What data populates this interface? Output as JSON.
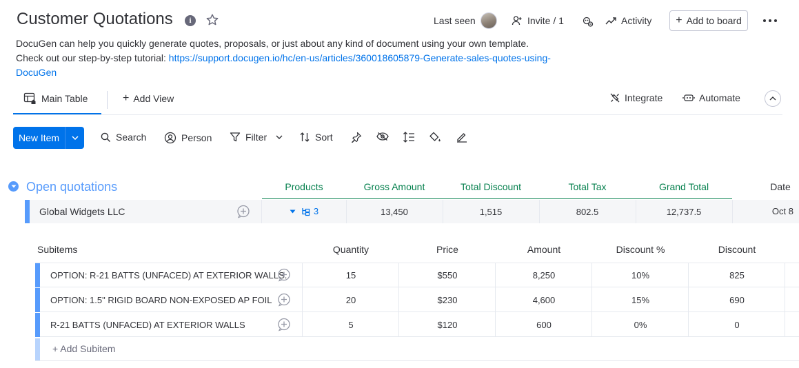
{
  "header": {
    "title": "Customer Quotations",
    "last_seen_label": "Last seen",
    "invite_label": "Invite / 1",
    "activity_label": "Activity",
    "add_to_board_label": "Add to board"
  },
  "description": {
    "line1": "DocuGen can help you quickly generate quotes, proposals, or just about any kind of document using your own template.",
    "line2_prefix": "Check out our step-by-step tutorial: ",
    "link": "https://support.docugen.io/hc/en-us/articles/360018605879-Generate-sales-quotes-using-DocuGen"
  },
  "views": {
    "main_table": "Main Table",
    "add_view": "Add View",
    "integrate": "Integrate",
    "automate": "Automate"
  },
  "toolbar": {
    "new_item": "New Item",
    "search": "Search",
    "person": "Person",
    "filter": "Filter",
    "sort": "Sort"
  },
  "group": {
    "title": "Open quotations",
    "color": "#579bfc",
    "columns": [
      "Products",
      "Gross Amount",
      "Total Discount",
      "Total Tax",
      "Grand Total",
      "Date"
    ],
    "item": {
      "name": "Global Widgets LLC",
      "subitem_count": "3",
      "gross_amount": "13,450",
      "total_discount": "1,515",
      "total_tax": "802.5",
      "grand_total": "12,737.5",
      "date": "Oct 8"
    }
  },
  "subitems": {
    "columns": [
      "Subitems",
      "Quantity",
      "Price",
      "Amount",
      "Discount %",
      "Discount"
    ],
    "rows": [
      {
        "name": "OPTION: R-21 BATTS (UNFACED) AT EXTERIOR WALLS.",
        "quantity": "15",
        "price": "$550",
        "amount": "8,250",
        "discount_pct": "10%",
        "discount": "825"
      },
      {
        "name": "OPTION: 1.5\" RIGID BOARD NON-EXPOSED AP FOIL",
        "quantity": "20",
        "price": "$230",
        "amount": "4,600",
        "discount_pct": "15%",
        "discount": "690"
      },
      {
        "name": "R-21 BATTS (UNFACED) AT EXTERIOR WALLS",
        "quantity": "5",
        "price": "$120",
        "amount": "600",
        "discount_pct": "0%",
        "discount": "0"
      }
    ],
    "add_subitem": "+ Add Subitem"
  },
  "colors": {
    "primary": "#0073ea",
    "accent_green": "#037f4c",
    "group_blue": "#579bfc"
  }
}
